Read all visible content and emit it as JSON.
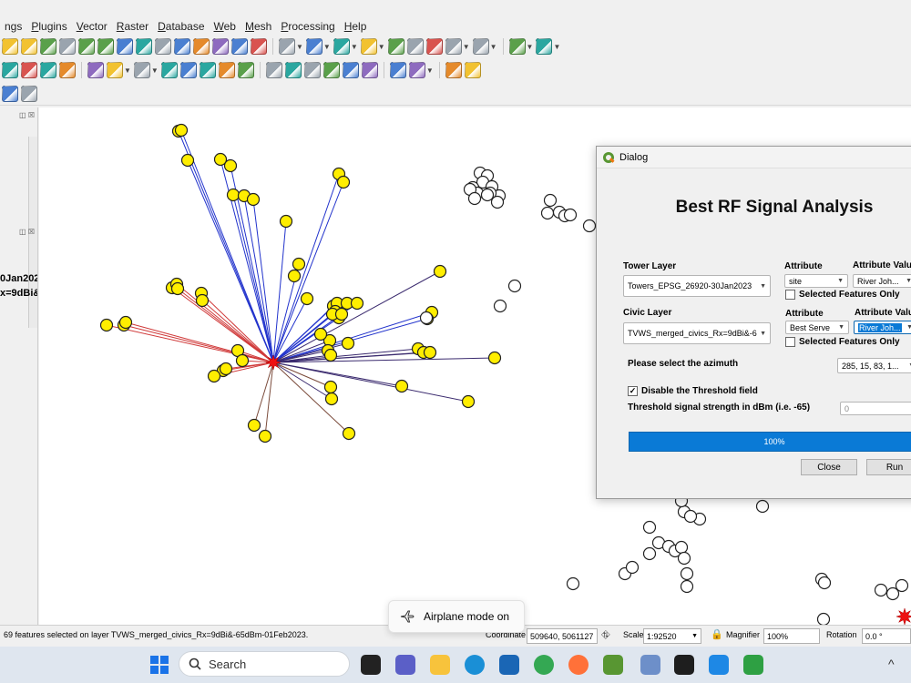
{
  "menubar": {
    "items": [
      "ngs",
      "Plugins",
      "Vector",
      "Raster",
      "Database",
      "Web",
      "Mesh",
      "Processing",
      "Help"
    ]
  },
  "toolbar_icons": {
    "row1": [
      "pan-icon",
      "pan-to-selection-icon",
      "zoom-in-icon",
      "zoom-out-icon",
      "zoom-full-icon",
      "zoom-selection-icon",
      "zoom-layer-icon",
      "zoom-native-icon",
      "zoom-last-icon",
      "zoom-next-icon",
      "new-bookmark-icon",
      "show-bookmarks-icon",
      "temporal-icon",
      "refresh-icon",
      "select-features-icon",
      "select-by-value-icon",
      "deselect-icon",
      "identify-icon",
      "attribute-table-icon",
      "field-calculator-icon",
      "statistics-icon",
      "open-table-icon",
      "measure-icon",
      "map-tips-icon",
      "settings-icon"
    ],
    "row2": [
      "digitize-icon",
      "edit-pencil-icon",
      "save-edits-icon",
      "add-point-icon",
      "vertex-tool-icon",
      "move-feature-icon",
      "delete-selected-icon",
      "cut-icon",
      "copy-icon",
      "paste-icon",
      "undo-icon",
      "redo-icon",
      "label-icon",
      "pin-label-icon",
      "highlight-label-icon",
      "label-properties-icon",
      "rotate-label-icon",
      "change-label-icon",
      "python-icon",
      "plugin-icon",
      "script-icon",
      "help-icon"
    ],
    "row3": [
      "info-icon",
      "wrench-icon"
    ]
  },
  "left_panel": {
    "text_line1": "0Jan202",
    "text_line2": "x=9dBi&"
  },
  "dialog": {
    "title": "Dialog",
    "heading": "Best RF Signal Analysis",
    "tower_layer_label": "Tower Layer",
    "tower_layer_value": "Towers_EPSG_26920-30Jan2023",
    "attribute_label_1": "Attribute",
    "attribute_value_label_1": "Attribute Valu",
    "attribute_combo_1": "site",
    "attribute_value_combo_1": "River Joh...",
    "selected_only_1": "Selected Features Only",
    "civic_layer_label": "Civic Layer",
    "civic_layer_value": "TVWS_merged_civics_Rx=9dBi&-6",
    "attribute_label_2": "Attribute",
    "attribute_value_label_2": "Attribute Valu",
    "attribute_combo_2": "Best Serve",
    "attribute_value_combo_2": "River Joh...",
    "selected_only_2": "Selected Features Only",
    "azimuth_label": "Please select the azimuth",
    "azimuth_value": "285, 15, 83, 1...",
    "disable_threshold_label": "Disable the Threshold field",
    "disable_threshold_checked": true,
    "threshold_label": "Threshold signal strength in dBm (i.e. -65)",
    "threshold_value": "0",
    "progress_text": "100%",
    "progress_fraction": 1.0,
    "close_label": "Close",
    "run_label": "Run"
  },
  "statusbar": {
    "message": "69 features selected on layer TVWS_merged_civics_Rx=9dBi&-65dBm-01Feb2023.",
    "coordinate_label": "Coordinate",
    "coordinate_value": "509640, 5061127",
    "scale_label": "Scale",
    "scale_value": "1:92520",
    "magnifier_label": "Magnifier",
    "magnifier_value": "100%",
    "rotation_label": "Rotation",
    "rotation_value": "0.0 °"
  },
  "toast": {
    "text": "Airplane mode on"
  },
  "taskbar": {
    "search_placeholder": "Search",
    "apps": [
      "windows-start-icon",
      "task-view-icon",
      "teams-icon",
      "file-explorer-icon",
      "edge-icon",
      "store-icon",
      "chrome-icon",
      "firefox-icon",
      "qgis-icon",
      "calendar-icon",
      "terminal-icon",
      "vscode-icon",
      "app-d-icon"
    ]
  },
  "colors": {
    "selected_fill": "#ffee00",
    "line_blue": "#2233cc",
    "line_navy": "#3a2a6e",
    "line_red": "#d03a3a",
    "line_brown": "#7a4a3a",
    "tower_red": "#ee1111",
    "progress_blue": "#0a7ad6"
  }
}
